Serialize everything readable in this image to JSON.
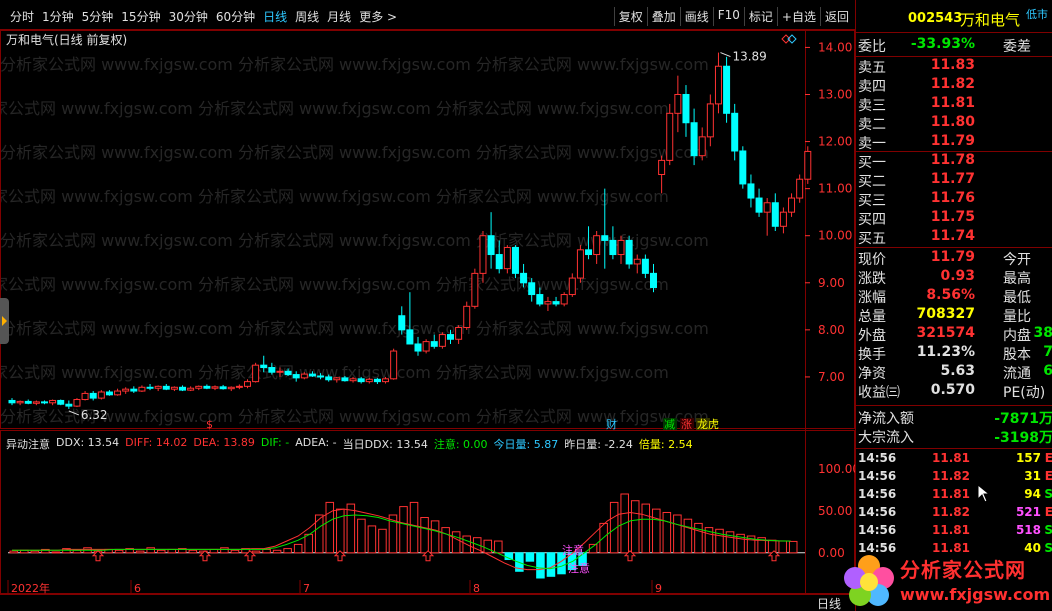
{
  "toolbar": {
    "periods": [
      "分时",
      "1分钟",
      "5分钟",
      "15分钟",
      "30分钟",
      "60分钟",
      "日线",
      "周线",
      "月线",
      "更多 >"
    ],
    "active_period": "日线",
    "tools": [
      "复权",
      "叠加",
      "画线",
      "F10",
      "标记",
      "+自选",
      "返回"
    ]
  },
  "chart_header": "万和电气(日线 前复权)",
  "price_axis": [
    "14.00",
    "13.00",
    "12.00",
    "11.00",
    "10.00",
    "9.00",
    "8.00",
    "7.00"
  ],
  "annotations": {
    "high_label": "13.89",
    "low_label": "6.32"
  },
  "markers": {
    "dollar": "$",
    "cai": "财",
    "jian": "减",
    "zhang": "涨",
    "longhu": "龙虎"
  },
  "indicator": {
    "name": "异动注意",
    "items": [
      {
        "text": "DDX: 13.54",
        "color": "#e0e0e0"
      },
      {
        "text": "DIFF: 14.02",
        "color": "#ff3232"
      },
      {
        "text": "DEA: 13.89",
        "color": "#ff3232"
      },
      {
        "text": "DIF: -",
        "color": "#00e600"
      },
      {
        "text": "ADEA: -",
        "color": "#e0e0e0"
      },
      {
        "text": "当日DDX: 13.54",
        "color": "#e0e0e0"
      },
      {
        "text": "注意: 0.00",
        "color": "#00e600"
      },
      {
        "text": "今日量: 5.87",
        "color": "#2ec8ff"
      },
      {
        "text": "昨日量: -2.24",
        "color": "#e0e0e0"
      },
      {
        "text": "倍量: 2.54",
        "color": "#ffff00"
      }
    ],
    "axis": [
      "100.00",
      "50.00",
      "0.00"
    ],
    "labels": {
      "zhuyi1": "注意",
      "zhuyi2": "注意"
    }
  },
  "date_axis": [
    "2022年",
    "6",
    "7",
    "8",
    "9"
  ],
  "bottom_bar": {
    "mode": "日线"
  },
  "quote": {
    "code": "002543",
    "name": "万和电气",
    "market_tag": "低市",
    "weibi": {
      "label": "委比",
      "value": "-33.93%",
      "label2": "委差"
    },
    "sell": [
      {
        "label": "卖五",
        "price": "11.83"
      },
      {
        "label": "卖四",
        "price": "11.82"
      },
      {
        "label": "卖三",
        "price": "11.81"
      },
      {
        "label": "卖二",
        "price": "11.80"
      },
      {
        "label": "卖一",
        "price": "11.79"
      }
    ],
    "buy": [
      {
        "label": "买一",
        "price": "11.78"
      },
      {
        "label": "买二",
        "price": "11.77"
      },
      {
        "label": "买三",
        "price": "11.76"
      },
      {
        "label": "买四",
        "price": "11.75"
      },
      {
        "label": "买五",
        "price": "11.74"
      }
    ],
    "stats": [
      {
        "label": "现价",
        "value": "11.79",
        "color": "#ff3232",
        "label2": "今开",
        "value2": ""
      },
      {
        "label": "涨跌",
        "value": "0.93",
        "color": "#ff3232",
        "label2": "最高",
        "value2": ""
      },
      {
        "label": "涨幅",
        "value": "8.56%",
        "color": "#ff3232",
        "label2": "最低",
        "value2": ""
      },
      {
        "label": "总量",
        "value": "708327",
        "color": "#ffff00",
        "label2": "量比",
        "value2": ""
      },
      {
        "label": "外盘",
        "value": "321574",
        "color": "#ff3232",
        "label2": "内盘",
        "value2": "38"
      },
      {
        "label": "换手",
        "value": "11.23%",
        "color": "#e0e0e0",
        "label2": "股本",
        "value2": "7"
      },
      {
        "label": "净资",
        "value": "5.63",
        "color": "#e0e0e0",
        "label2": "流通",
        "value2": "6"
      },
      {
        "label": "收益㈢",
        "value": "0.570",
        "color": "#e0e0e0",
        "label2": "PE(动)",
        "value2": ""
      }
    ],
    "flow": [
      {
        "label": "净流入额",
        "value": "-7871万"
      },
      {
        "label": "大宗流入",
        "value": "-3198万"
      }
    ],
    "ticks": [
      {
        "time": "14:56",
        "price": "11.81",
        "vol": "157",
        "vcolor": "#ffff00",
        "dir": "E"
      },
      {
        "time": "14:56",
        "price": "11.82",
        "vol": "31",
        "vcolor": "#ffff00",
        "dir": "E"
      },
      {
        "time": "14:56",
        "price": "11.81",
        "vol": "94",
        "vcolor": "#ffff00",
        "dir": "S"
      },
      {
        "time": "14:56",
        "price": "11.82",
        "vol": "521",
        "vcolor": "#ff50ff",
        "dir": "E"
      },
      {
        "time": "14:56",
        "price": "11.81",
        "vol": "518",
        "vcolor": "#ff50ff",
        "dir": "S"
      },
      {
        "time": "14:56",
        "price": "11.81",
        "vol": "40",
        "vcolor": "#ffff00",
        "dir": "S"
      }
    ]
  },
  "watermark": {
    "name": "分析家公式网",
    "url": "www.fxjgsw.com",
    "bg_text": "分析家公式网 www.fxjgsw.com"
  },
  "chart_data": {
    "type": "candlestick",
    "title": "万和电气(日线 前复权)",
    "ylim": [
      6.0,
      14.2
    ],
    "y_ticks": [
      14.0,
      13.0,
      12.0,
      11.0,
      10.0,
      9.0,
      8.0,
      7.0
    ],
    "x_labels": [
      "2022年",
      "6",
      "7",
      "8",
      "9"
    ],
    "annotated_high": 13.89,
    "annotated_low": 6.32,
    "candles": [
      [
        6.5,
        6.55,
        6.4,
        6.45
      ],
      [
        6.45,
        6.5,
        6.4,
        6.48
      ],
      [
        6.48,
        6.52,
        6.42,
        6.44
      ],
      [
        6.44,
        6.5,
        6.4,
        6.47
      ],
      [
        6.47,
        6.5,
        6.42,
        6.45
      ],
      [
        6.45,
        6.52,
        6.4,
        6.5
      ],
      [
        6.5,
        6.52,
        6.4,
        6.42
      ],
      [
        6.42,
        6.5,
        6.32,
        6.38
      ],
      [
        6.38,
        6.55,
        6.36,
        6.52
      ],
      [
        6.52,
        6.7,
        6.5,
        6.65
      ],
      [
        6.65,
        6.7,
        6.5,
        6.55
      ],
      [
        6.55,
        6.72,
        6.52,
        6.68
      ],
      [
        6.68,
        6.72,
        6.6,
        6.62
      ],
      [
        6.62,
        6.75,
        6.6,
        6.7
      ],
      [
        6.7,
        6.78,
        6.64,
        6.74
      ],
      [
        6.74,
        6.8,
        6.66,
        6.7
      ],
      [
        6.7,
        6.82,
        6.68,
        6.78
      ],
      [
        6.78,
        6.85,
        6.72,
        6.76
      ],
      [
        6.76,
        6.82,
        6.7,
        6.8
      ],
      [
        6.8,
        6.85,
        6.72,
        6.74
      ],
      [
        6.74,
        6.8,
        6.7,
        6.78
      ],
      [
        6.78,
        6.82,
        6.7,
        6.72
      ],
      [
        6.72,
        6.8,
        6.7,
        6.76
      ],
      [
        6.76,
        6.82,
        6.72,
        6.8
      ],
      [
        6.8,
        6.84,
        6.74,
        6.76
      ],
      [
        6.76,
        6.82,
        6.72,
        6.79
      ],
      [
        6.79,
        6.83,
        6.73,
        6.75
      ],
      [
        6.75,
        6.8,
        6.7,
        6.78
      ],
      [
        6.78,
        6.84,
        6.74,
        6.8
      ],
      [
        6.8,
        6.95,
        6.76,
        6.9
      ],
      [
        6.9,
        7.3,
        6.88,
        7.25
      ],
      [
        7.25,
        7.45,
        7.1,
        7.2
      ],
      [
        7.2,
        7.3,
        7.05,
        7.1
      ],
      [
        7.1,
        7.2,
        7.0,
        7.12
      ],
      [
        7.12,
        7.18,
        7.02,
        7.05
      ],
      [
        7.05,
        7.12,
        6.9,
        6.98
      ],
      [
        6.98,
        7.1,
        6.95,
        7.06
      ],
      [
        7.06,
        7.12,
        7.0,
        7.02
      ],
      [
        7.02,
        7.08,
        6.95,
        7.0
      ],
      [
        7.0,
        7.05,
        6.9,
        6.94
      ],
      [
        6.94,
        7.0,
        6.88,
        6.98
      ],
      [
        6.98,
        7.02,
        6.9,
        6.92
      ],
      [
        6.92,
        7.0,
        6.88,
        6.96
      ],
      [
        6.96,
        7.0,
        6.86,
        6.9
      ],
      [
        6.9,
        6.98,
        6.86,
        6.95
      ],
      [
        6.95,
        6.98,
        6.85,
        6.9
      ],
      [
        6.9,
        7.0,
        6.86,
        6.96
      ],
      [
        6.96,
        7.6,
        6.94,
        7.55
      ],
      [
        8.3,
        8.5,
        7.9,
        8.0
      ],
      [
        8.0,
        8.8,
        7.8,
        7.7
      ],
      [
        7.7,
        7.85,
        7.45,
        7.55
      ],
      [
        7.55,
        7.8,
        7.5,
        7.75
      ],
      [
        7.75,
        7.9,
        7.6,
        7.65
      ],
      [
        7.65,
        7.95,
        7.6,
        7.9
      ],
      [
        7.9,
        8.0,
        7.7,
        7.8
      ],
      [
        7.8,
        8.1,
        7.7,
        8.05
      ],
      [
        8.05,
        8.6,
        8.0,
        8.5
      ],
      [
        8.5,
        9.3,
        8.45,
        9.2
      ],
      [
        9.2,
        10.1,
        9.0,
        10.0
      ],
      [
        10.0,
        10.5,
        9.3,
        9.6
      ],
      [
        9.6,
        9.9,
        9.2,
        9.3
      ],
      [
        9.3,
        9.8,
        9.2,
        9.75
      ],
      [
        9.75,
        9.8,
        9.1,
        9.2
      ],
      [
        9.2,
        9.4,
        8.9,
        9.0
      ],
      [
        9.0,
        9.1,
        8.6,
        8.75
      ],
      [
        8.75,
        8.9,
        8.5,
        8.55
      ],
      [
        8.55,
        8.7,
        8.4,
        8.6
      ],
      [
        8.6,
        8.7,
        8.5,
        8.55
      ],
      [
        8.55,
        8.8,
        8.5,
        8.75
      ],
      [
        8.75,
        9.2,
        8.7,
        9.1
      ],
      [
        9.1,
        9.8,
        9.0,
        9.7
      ],
      [
        9.7,
        10.2,
        9.5,
        9.6
      ],
      [
        9.6,
        10.1,
        9.4,
        10.0
      ],
      [
        10.0,
        11.0,
        9.3,
        9.9
      ],
      [
        9.9,
        10.2,
        9.5,
        9.6
      ],
      [
        9.6,
        10.0,
        9.4,
        9.9
      ],
      [
        9.9,
        10.0,
        9.3,
        9.4
      ],
      [
        9.4,
        9.6,
        9.2,
        9.5
      ],
      [
        9.5,
        9.6,
        9.1,
        9.2
      ],
      [
        9.2,
        9.4,
        8.8,
        8.9
      ],
      [
        11.3,
        11.7,
        10.9,
        11.6
      ],
      [
        11.6,
        12.8,
        11.5,
        12.6
      ],
      [
        12.6,
        13.4,
        12.2,
        13.0
      ],
      [
        13.0,
        13.2,
        12.1,
        12.4
      ],
      [
        12.4,
        12.7,
        11.5,
        11.7
      ],
      [
        11.7,
        12.3,
        11.6,
        12.1
      ],
      [
        12.1,
        13.0,
        11.9,
        12.8
      ],
      [
        12.8,
        13.89,
        12.6,
        13.6
      ],
      [
        13.6,
        13.8,
        12.4,
        12.6
      ],
      [
        12.6,
        12.8,
        11.6,
        11.8
      ],
      [
        11.8,
        11.9,
        11.0,
        11.1
      ],
      [
        11.1,
        11.3,
        10.6,
        10.8
      ],
      [
        10.8,
        11.0,
        10.4,
        10.5
      ],
      [
        10.5,
        10.8,
        10.0,
        10.7
      ],
      [
        10.7,
        10.9,
        10.1,
        10.2
      ],
      [
        10.2,
        10.6,
        10.05,
        10.5
      ],
      [
        10.5,
        10.9,
        10.4,
        10.8
      ],
      [
        10.8,
        11.3,
        10.7,
        11.2
      ],
      [
        11.2,
        11.9,
        11.1,
        11.79
      ]
    ],
    "indicator_series": [
      {
        "name": "DDX",
        "values": [
          2,
          3,
          2,
          4,
          1,
          5,
          3,
          6,
          2,
          4,
          3,
          5,
          2,
          6,
          3,
          4,
          5,
          3,
          2,
          4,
          6,
          3,
          5,
          2,
          4,
          3,
          5,
          10,
          22,
          45,
          60,
          52,
          58,
          40,
          32,
          28,
          45,
          55,
          60,
          42,
          38,
          30,
          25,
          20,
          18,
          15,
          14,
          -8,
          -22,
          -10,
          -30,
          -28,
          -25,
          -20,
          -15,
          10,
          35,
          60,
          70,
          62,
          58,
          52,
          48,
          45,
          40,
          35,
          30,
          28,
          25,
          22,
          20,
          18,
          15,
          14,
          13.54
        ]
      },
      {
        "name": "DIFF",
        "values": [
          3,
          3,
          3,
          3,
          3,
          4,
          4,
          4,
          4,
          4,
          4,
          4,
          4,
          4,
          4,
          4,
          4,
          4,
          4,
          4,
          4,
          5,
          5,
          8,
          14,
          20,
          30,
          42,
          50,
          52,
          50,
          47,
          44,
          40,
          36,
          33,
          30,
          27,
          22,
          15,
          8,
          2,
          -5,
          -12,
          -18,
          -20,
          -20,
          -18,
          -10,
          0,
          12,
          25,
          38,
          46,
          48,
          46,
          42,
          38,
          34,
          30,
          26,
          22,
          20,
          18,
          16,
          15,
          14.5,
          14.2,
          14.02
        ]
      },
      {
        "name": "DEA",
        "values": [
          3,
          3,
          3,
          3,
          3,
          3,
          3,
          3,
          3,
          4,
          4,
          4,
          4,
          4,
          4,
          4,
          4,
          4,
          4,
          4,
          4,
          4,
          4,
          6,
          10,
          15,
          22,
          32,
          40,
          44,
          45,
          44,
          42,
          38,
          35,
          32,
          29,
          26,
          22,
          18,
          13,
          8,
          2,
          -4,
          -10,
          -15,
          -18,
          -19,
          -16,
          -10,
          0,
          10,
          22,
          32,
          38,
          40,
          40,
          38,
          34,
          31,
          28,
          25,
          22,
          20,
          18,
          16,
          15,
          14.2,
          13.89
        ]
      }
    ],
    "indicator_ylim": [
      -30,
      120
    ]
  }
}
